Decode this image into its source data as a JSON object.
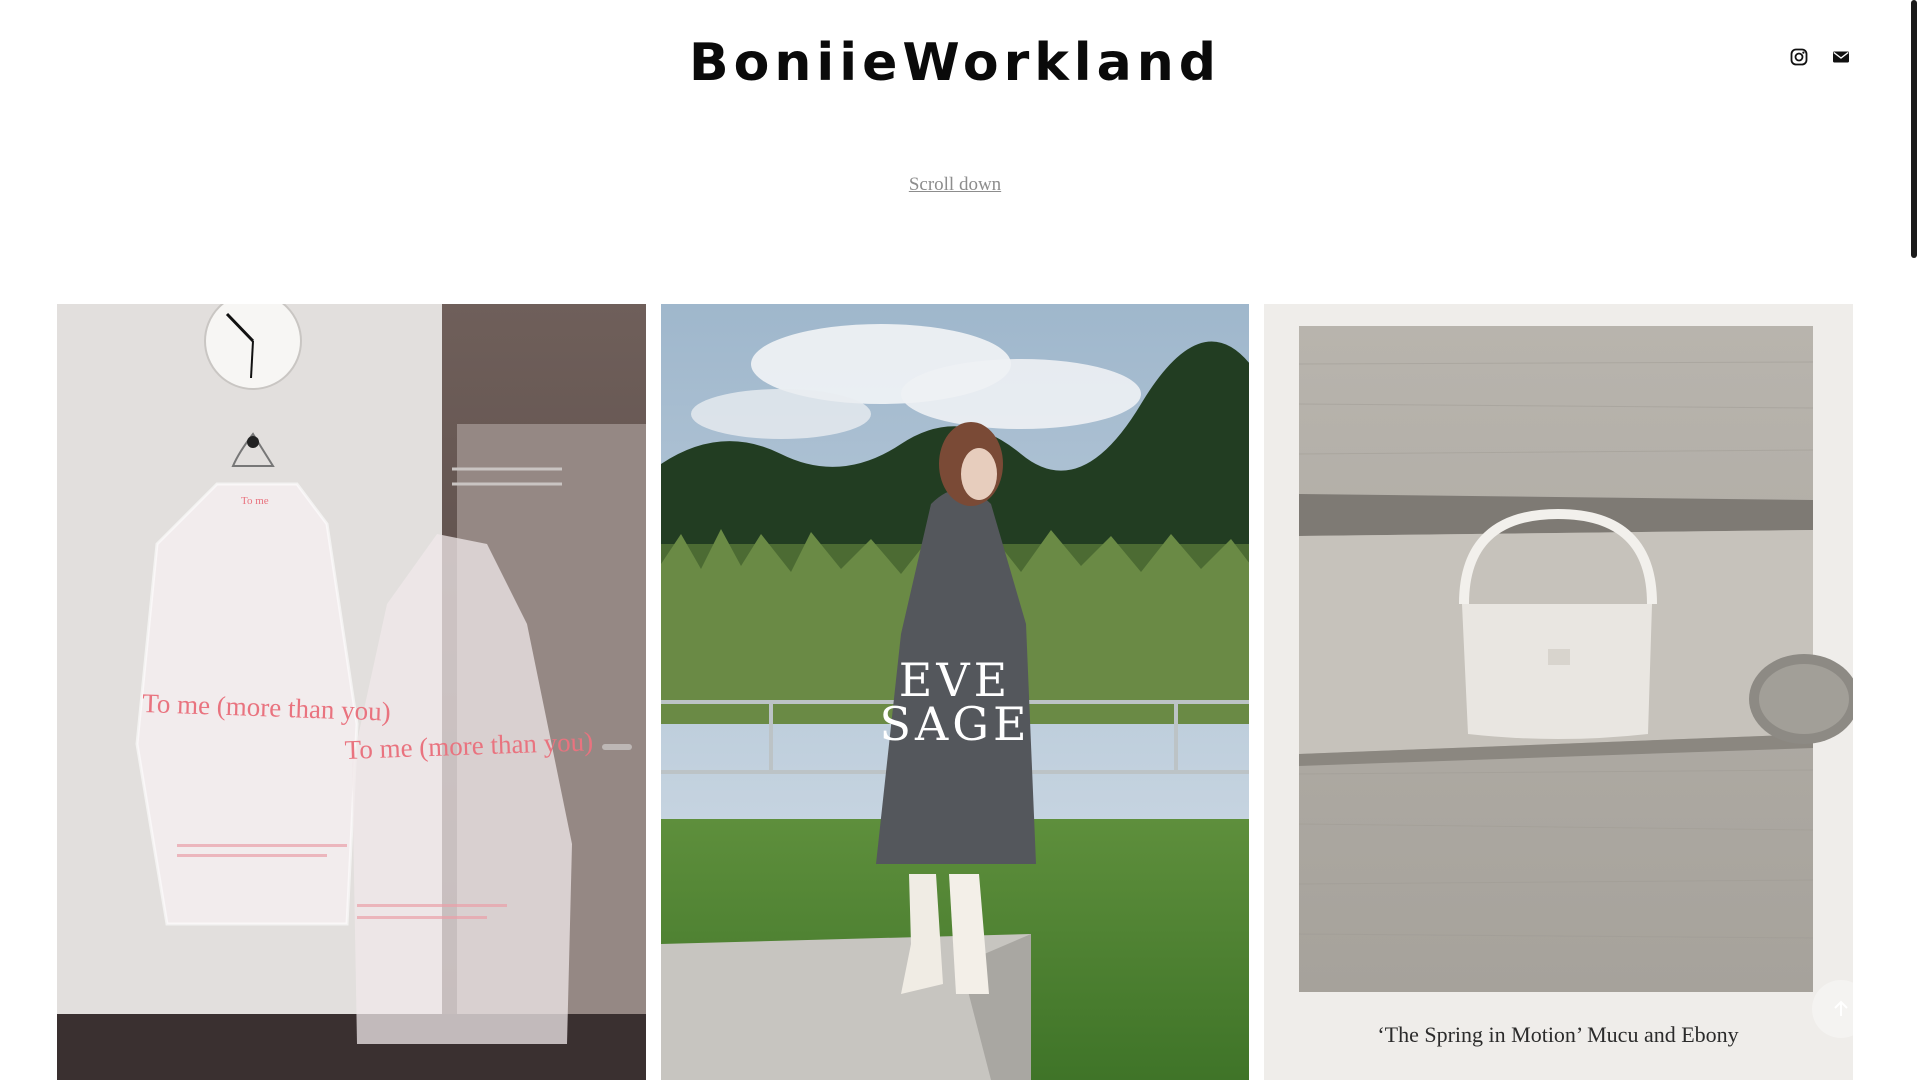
{
  "header": {
    "title": "BoniieWorkland",
    "social": [
      {
        "icon": "instagram-icon"
      },
      {
        "icon": "mail-icon"
      }
    ]
  },
  "scroll_hint": "Scroll down",
  "gallery": {
    "items": [
      {
        "subject": "garment bags on hangers",
        "print_line_1": "To me (more than you)",
        "print_line_2": "To me (more than you)",
        "hanger_tag": "To me"
      },
      {
        "subject": "model in grey coat in a field",
        "logo_line_1": "EVE",
        "logo_line_2": "SAGE"
      },
      {
        "subject": "white handbag on a shelf",
        "caption": "‘The Spring in Motion’  Mucu and Ebony"
      }
    ]
  },
  "colors": {
    "title": "#0a0a0a",
    "scroll_hint": "#8d8d8d",
    "accent_pink": "#e9737f"
  },
  "icons": {
    "back_to_top": "arrow-up-icon"
  }
}
